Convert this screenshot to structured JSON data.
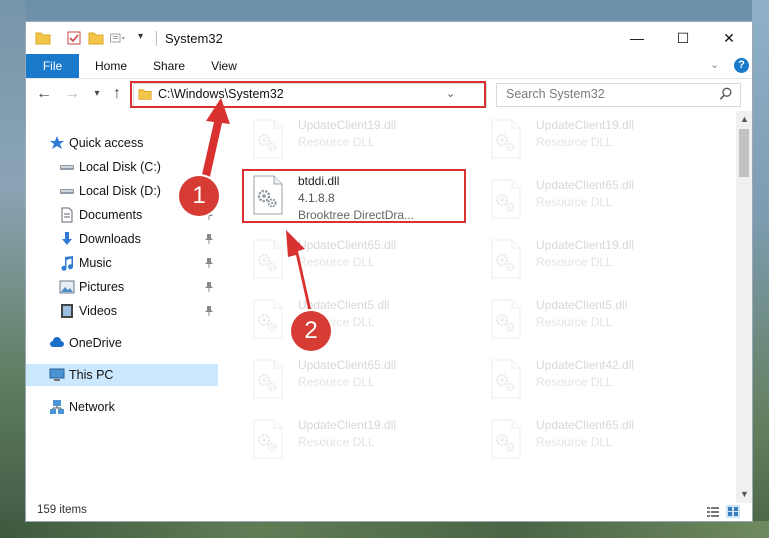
{
  "window": {
    "title": "System32",
    "minimize": "—",
    "maximize": "☐",
    "close": "✕"
  },
  "ribbon": {
    "tabs": [
      "File",
      "Home",
      "Share",
      "View"
    ],
    "help": "?"
  },
  "navigation": {
    "back": "←",
    "forward": "→",
    "recent": "▾",
    "up": "↑",
    "address": "C:\\Windows\\System32",
    "address_dropdown": "⌄",
    "refresh": "↻",
    "search_placeholder": "Search System32"
  },
  "sidebar": {
    "items": [
      {
        "label": "Quick access",
        "icon": "star-icon",
        "pinned": false
      },
      {
        "label": "Local Disk (C:)",
        "icon": "drive-icon",
        "pinned": false
      },
      {
        "label": "Local Disk (D:)",
        "icon": "drive-icon",
        "pinned": false
      },
      {
        "label": "Documents",
        "icon": "documents-icon",
        "pinned": true
      },
      {
        "label": "Downloads",
        "icon": "download-icon",
        "pinned": true
      },
      {
        "label": "Music",
        "icon": "music-icon",
        "pinned": true
      },
      {
        "label": "Pictures",
        "icon": "pictures-icon",
        "pinned": true
      },
      {
        "label": "Videos",
        "icon": "videos-icon",
        "pinned": true
      },
      {
        "label": "OneDrive",
        "icon": "cloud-icon",
        "pinned": false
      },
      {
        "label": "This PC",
        "icon": "computer-icon",
        "pinned": false,
        "selected": true
      },
      {
        "label": "Network",
        "icon": "network-icon",
        "pinned": false
      }
    ],
    "pin_glyph": "📌"
  },
  "files": {
    "focused": {
      "name": "btddi.dll",
      "version": "4.1.8.8",
      "description": "Brooktree DirectDra..."
    },
    "left_column": [
      {
        "name": "UpdateClient19.dll",
        "type": "Resource DLL"
      },
      {
        "name": "UpdateClient65.dll",
        "type": "Resource DLL"
      },
      {
        "name": "UpdateClient5.dll",
        "type": "Resource DLL"
      },
      {
        "name": "UpdateClient65.dll",
        "type": "Resource DLL"
      },
      {
        "name": "UpdateClient19.dll",
        "type": "Resource DLL"
      }
    ],
    "right_column": [
      {
        "name": "UpdateClient19.dll",
        "type": "Resource DLL"
      },
      {
        "name": "UpdateClient65.dll",
        "type": "Resource DLL"
      },
      {
        "name": "UpdateClient19.dll",
        "type": "Resource DLL"
      },
      {
        "name": "UpdateClient5.dll",
        "type": "Resource DLL"
      },
      {
        "name": "UpdateClient42.dll",
        "type": "Resource DLL"
      },
      {
        "name": "UpdateClient65.dll",
        "type": "Resource DLL"
      }
    ]
  },
  "status": {
    "count": "159 items"
  },
  "callouts": {
    "step1": "1",
    "step2": "2",
    "color": "#d9312f"
  }
}
